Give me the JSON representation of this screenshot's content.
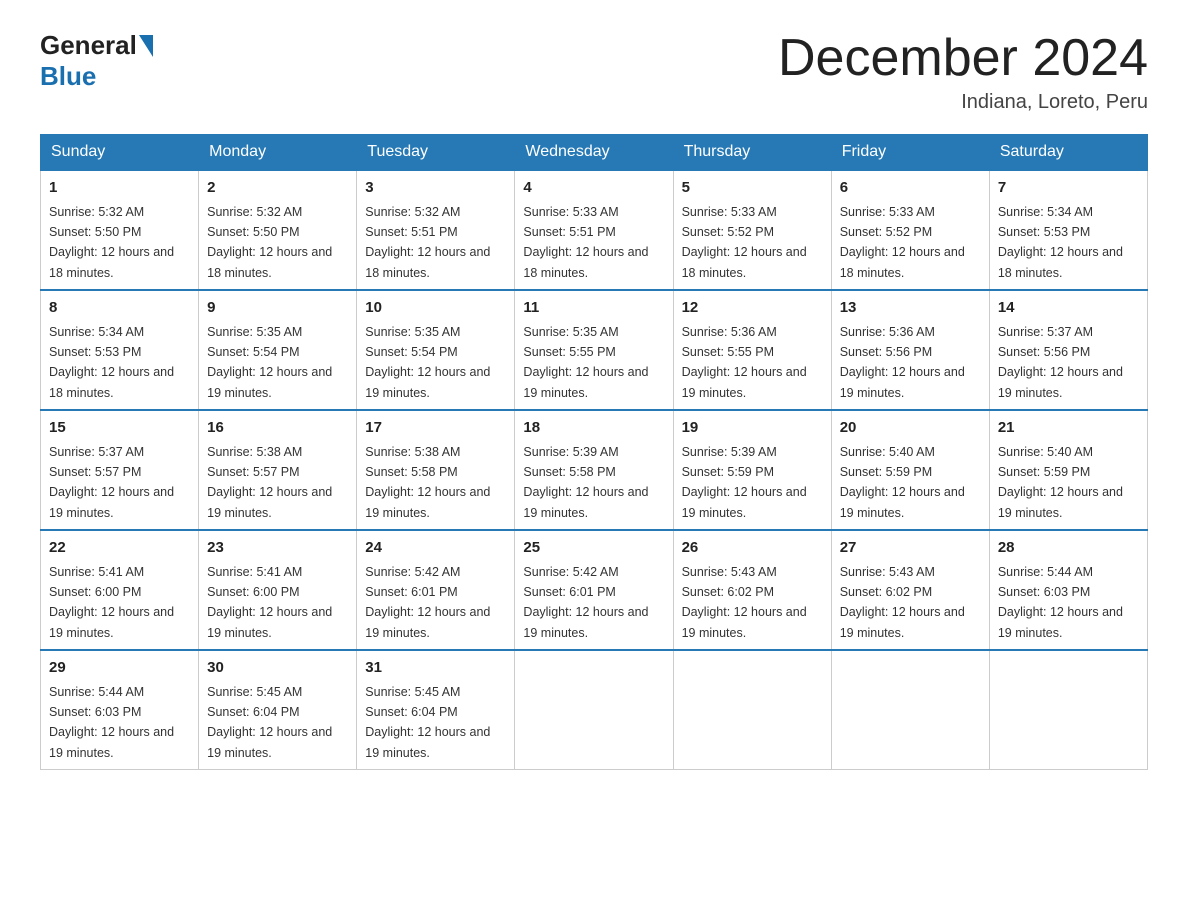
{
  "header": {
    "logo_general": "General",
    "logo_blue": "Blue",
    "month_year": "December 2024",
    "location": "Indiana, Loreto, Peru"
  },
  "days_of_week": [
    "Sunday",
    "Monday",
    "Tuesday",
    "Wednesday",
    "Thursday",
    "Friday",
    "Saturday"
  ],
  "weeks": [
    [
      {
        "day": "1",
        "sunrise": "5:32 AM",
        "sunset": "5:50 PM",
        "daylight": "12 hours and 18 minutes."
      },
      {
        "day": "2",
        "sunrise": "5:32 AM",
        "sunset": "5:50 PM",
        "daylight": "12 hours and 18 minutes."
      },
      {
        "day": "3",
        "sunrise": "5:32 AM",
        "sunset": "5:51 PM",
        "daylight": "12 hours and 18 minutes."
      },
      {
        "day": "4",
        "sunrise": "5:33 AM",
        "sunset": "5:51 PM",
        "daylight": "12 hours and 18 minutes."
      },
      {
        "day": "5",
        "sunrise": "5:33 AM",
        "sunset": "5:52 PM",
        "daylight": "12 hours and 18 minutes."
      },
      {
        "day": "6",
        "sunrise": "5:33 AM",
        "sunset": "5:52 PM",
        "daylight": "12 hours and 18 minutes."
      },
      {
        "day": "7",
        "sunrise": "5:34 AM",
        "sunset": "5:53 PM",
        "daylight": "12 hours and 18 minutes."
      }
    ],
    [
      {
        "day": "8",
        "sunrise": "5:34 AM",
        "sunset": "5:53 PM",
        "daylight": "12 hours and 18 minutes."
      },
      {
        "day": "9",
        "sunrise": "5:35 AM",
        "sunset": "5:54 PM",
        "daylight": "12 hours and 19 minutes."
      },
      {
        "day": "10",
        "sunrise": "5:35 AM",
        "sunset": "5:54 PM",
        "daylight": "12 hours and 19 minutes."
      },
      {
        "day": "11",
        "sunrise": "5:35 AM",
        "sunset": "5:55 PM",
        "daylight": "12 hours and 19 minutes."
      },
      {
        "day": "12",
        "sunrise": "5:36 AM",
        "sunset": "5:55 PM",
        "daylight": "12 hours and 19 minutes."
      },
      {
        "day": "13",
        "sunrise": "5:36 AM",
        "sunset": "5:56 PM",
        "daylight": "12 hours and 19 minutes."
      },
      {
        "day": "14",
        "sunrise": "5:37 AM",
        "sunset": "5:56 PM",
        "daylight": "12 hours and 19 minutes."
      }
    ],
    [
      {
        "day": "15",
        "sunrise": "5:37 AM",
        "sunset": "5:57 PM",
        "daylight": "12 hours and 19 minutes."
      },
      {
        "day": "16",
        "sunrise": "5:38 AM",
        "sunset": "5:57 PM",
        "daylight": "12 hours and 19 minutes."
      },
      {
        "day": "17",
        "sunrise": "5:38 AM",
        "sunset": "5:58 PM",
        "daylight": "12 hours and 19 minutes."
      },
      {
        "day": "18",
        "sunrise": "5:39 AM",
        "sunset": "5:58 PM",
        "daylight": "12 hours and 19 minutes."
      },
      {
        "day": "19",
        "sunrise": "5:39 AM",
        "sunset": "5:59 PM",
        "daylight": "12 hours and 19 minutes."
      },
      {
        "day": "20",
        "sunrise": "5:40 AM",
        "sunset": "5:59 PM",
        "daylight": "12 hours and 19 minutes."
      },
      {
        "day": "21",
        "sunrise": "5:40 AM",
        "sunset": "5:59 PM",
        "daylight": "12 hours and 19 minutes."
      }
    ],
    [
      {
        "day": "22",
        "sunrise": "5:41 AM",
        "sunset": "6:00 PM",
        "daylight": "12 hours and 19 minutes."
      },
      {
        "day": "23",
        "sunrise": "5:41 AM",
        "sunset": "6:00 PM",
        "daylight": "12 hours and 19 minutes."
      },
      {
        "day": "24",
        "sunrise": "5:42 AM",
        "sunset": "6:01 PM",
        "daylight": "12 hours and 19 minutes."
      },
      {
        "day": "25",
        "sunrise": "5:42 AM",
        "sunset": "6:01 PM",
        "daylight": "12 hours and 19 minutes."
      },
      {
        "day": "26",
        "sunrise": "5:43 AM",
        "sunset": "6:02 PM",
        "daylight": "12 hours and 19 minutes."
      },
      {
        "day": "27",
        "sunrise": "5:43 AM",
        "sunset": "6:02 PM",
        "daylight": "12 hours and 19 minutes."
      },
      {
        "day": "28",
        "sunrise": "5:44 AM",
        "sunset": "6:03 PM",
        "daylight": "12 hours and 19 minutes."
      }
    ],
    [
      {
        "day": "29",
        "sunrise": "5:44 AM",
        "sunset": "6:03 PM",
        "daylight": "12 hours and 19 minutes."
      },
      {
        "day": "30",
        "sunrise": "5:45 AM",
        "sunset": "6:04 PM",
        "daylight": "12 hours and 19 minutes."
      },
      {
        "day": "31",
        "sunrise": "5:45 AM",
        "sunset": "6:04 PM",
        "daylight": "12 hours and 19 minutes."
      },
      {
        "day": "",
        "sunrise": "",
        "sunset": "",
        "daylight": ""
      },
      {
        "day": "",
        "sunrise": "",
        "sunset": "",
        "daylight": ""
      },
      {
        "day": "",
        "sunrise": "",
        "sunset": "",
        "daylight": ""
      },
      {
        "day": "",
        "sunrise": "",
        "sunset": "",
        "daylight": ""
      }
    ]
  ]
}
